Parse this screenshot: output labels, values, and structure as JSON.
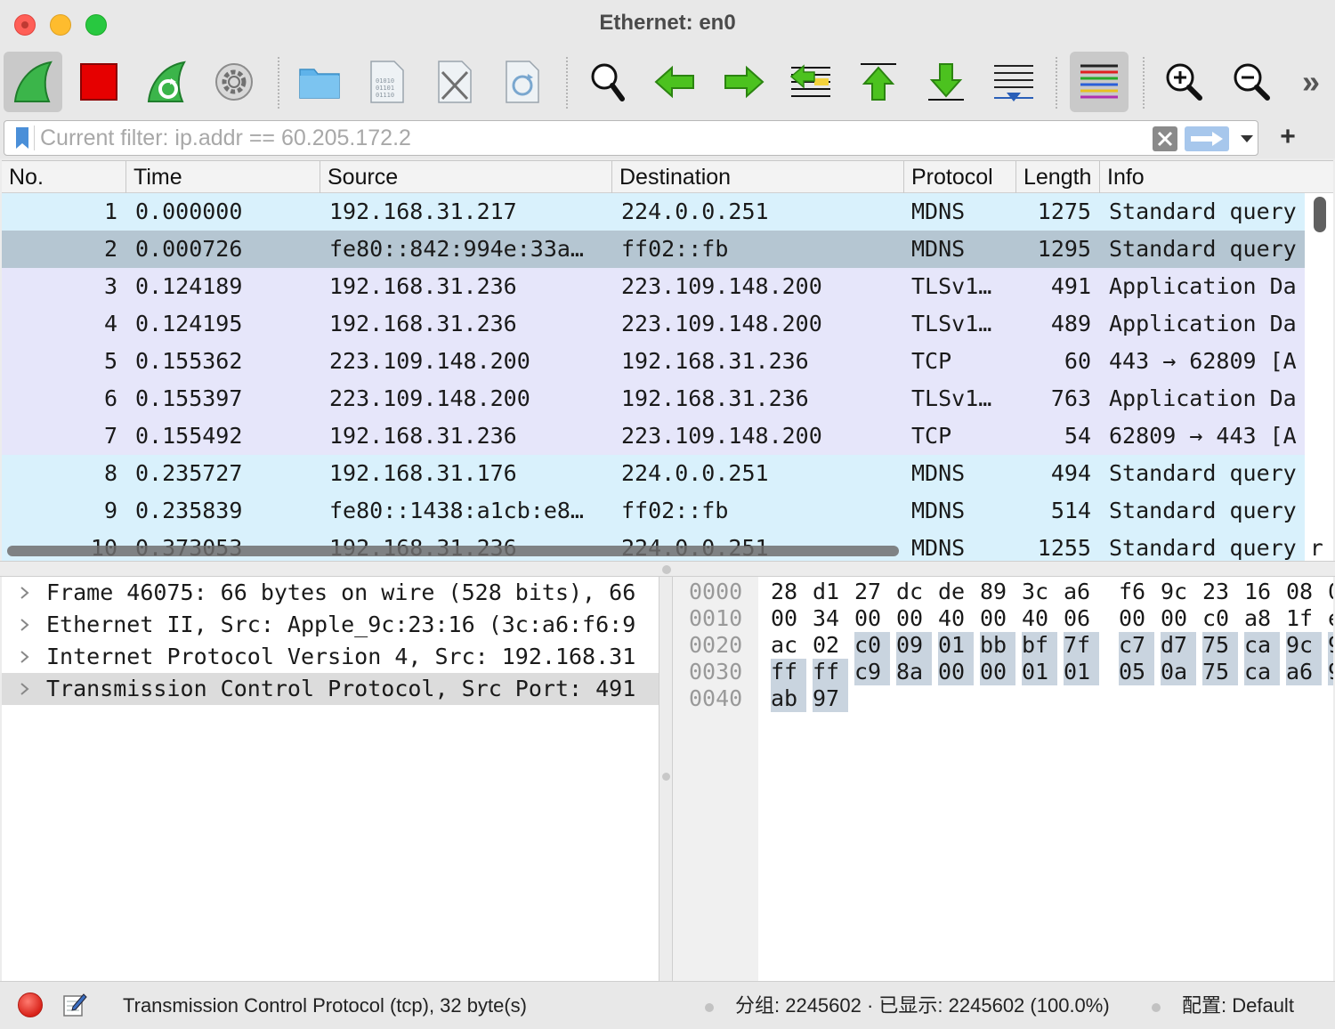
{
  "window": {
    "title": "Ethernet: en0"
  },
  "toolbar": {
    "buttons": [
      {
        "name": "start-capture",
        "icon": "shark-fin-icon"
      },
      {
        "name": "stop-capture",
        "icon": "stop-square-icon"
      },
      {
        "name": "restart-capture",
        "icon": "restart-fin-icon"
      },
      {
        "name": "capture-options",
        "icon": "gear-icon"
      },
      {
        "name": "open-file",
        "icon": "folder-icon"
      },
      {
        "name": "save-file",
        "icon": "binary-file-icon"
      },
      {
        "name": "close-file",
        "icon": "close-file-icon"
      },
      {
        "name": "reload-file",
        "icon": "reload-file-icon"
      },
      {
        "name": "find-packet",
        "icon": "magnifier-icon"
      },
      {
        "name": "go-back",
        "icon": "arrow-left-icon"
      },
      {
        "name": "go-forward",
        "icon": "arrow-right-icon"
      },
      {
        "name": "go-to-packet",
        "icon": "goto-packet-icon"
      },
      {
        "name": "go-first",
        "icon": "arrow-up-first-icon"
      },
      {
        "name": "go-last",
        "icon": "arrow-down-last-icon"
      },
      {
        "name": "auto-scroll",
        "icon": "autoscroll-icon"
      },
      {
        "name": "colorize",
        "icon": "colorize-lines-icon"
      },
      {
        "name": "zoom-in",
        "icon": "zoom-in-icon"
      },
      {
        "name": "zoom-out",
        "icon": "zoom-out-icon"
      },
      {
        "name": "more",
        "icon": "double-chevron-right-icon"
      }
    ],
    "more_label": "»"
  },
  "filter": {
    "placeholder": "Current filter: ip.addr == 60.205.172.2",
    "value": "",
    "add_label": "+"
  },
  "packet_list": {
    "columns": [
      "No.",
      "Time",
      "Source",
      "Destination",
      "Protocol",
      "Length",
      "Info"
    ],
    "rows": [
      {
        "no": "1",
        "time": "0.000000",
        "source": "192.168.31.217",
        "destination": "224.0.0.251",
        "protocol": "MDNS",
        "length": "1275",
        "info": "Standard query",
        "bg": "#d9f1fc"
      },
      {
        "no": "2",
        "time": "0.000726",
        "source": "fe80::842:994e:33a…",
        "destination": "ff02::fb",
        "protocol": "MDNS",
        "length": "1295",
        "info": "Standard query",
        "bg": "#b5c6d2"
      },
      {
        "no": "3",
        "time": "0.124189",
        "source": "192.168.31.236",
        "destination": "223.109.148.200",
        "protocol": "TLSv1…",
        "length": "491",
        "info": "Application Da",
        "bg": "#e6e6fa"
      },
      {
        "no": "4",
        "time": "0.124195",
        "source": "192.168.31.236",
        "destination": "223.109.148.200",
        "protocol": "TLSv1…",
        "length": "489",
        "info": "Application Da",
        "bg": "#e6e6fa"
      },
      {
        "no": "5",
        "time": "0.155362",
        "source": "223.109.148.200",
        "destination": "192.168.31.236",
        "protocol": "TCP",
        "length": "60",
        "info": "443 → 62809 [A",
        "bg": "#e6e6fa"
      },
      {
        "no": "6",
        "time": "0.155397",
        "source": "223.109.148.200",
        "destination": "192.168.31.236",
        "protocol": "TLSv1…",
        "length": "763",
        "info": "Application Da",
        "bg": "#e6e6fa"
      },
      {
        "no": "7",
        "time": "0.155492",
        "source": "192.168.31.236",
        "destination": "223.109.148.200",
        "protocol": "TCP",
        "length": "54",
        "info": "62809 → 443 [A",
        "bg": "#e6e6fa"
      },
      {
        "no": "8",
        "time": "0.235727",
        "source": "192.168.31.176",
        "destination": "224.0.0.251",
        "protocol": "MDNS",
        "length": "494",
        "info": "Standard query",
        "bg": "#d9f1fc"
      },
      {
        "no": "9",
        "time": "0.235839",
        "source": "fe80::1438:a1cb:e8…",
        "destination": "ff02::fb",
        "protocol": "MDNS",
        "length": "514",
        "info": "Standard query",
        "bg": "#d9f1fc"
      },
      {
        "no": "10",
        "time": "0.373053",
        "source": "192.168.31.236",
        "destination": "224.0.0.251",
        "protocol": "MDNS",
        "length": "1255",
        "info": "Standard query r",
        "bg": "#d9f1fc"
      }
    ]
  },
  "details": {
    "rows": [
      {
        "text": "Frame 46075: 66 bytes on wire (528 bits), 66",
        "selected": false
      },
      {
        "text": "Ethernet II, Src: Apple_9c:23:16 (3c:a6:f6:9",
        "selected": false
      },
      {
        "text": "Internet Protocol Version 4, Src: 192.168.31",
        "selected": false
      },
      {
        "text": "Transmission Control Protocol, Src Port: 491",
        "selected": true
      }
    ]
  },
  "bytes": {
    "rows": [
      {
        "offset": "0000",
        "hex": [
          "28",
          "d1",
          "27",
          "dc",
          "de",
          "89",
          "3c",
          "a6",
          "f6",
          "9c",
          "23",
          "16",
          "08",
          "0"
        ],
        "hl_from": 99
      },
      {
        "offset": "0010",
        "hex": [
          "00",
          "34",
          "00",
          "00",
          "40",
          "00",
          "40",
          "06",
          "00",
          "00",
          "c0",
          "a8",
          "1f",
          "e"
        ],
        "hl_from": 99
      },
      {
        "offset": "0020",
        "hex": [
          "ac",
          "02",
          "c0",
          "09",
          "01",
          "bb",
          "bf",
          "7f",
          "c7",
          "d7",
          "75",
          "ca",
          "9c",
          "9"
        ],
        "hl_from": 2
      },
      {
        "offset": "0030",
        "hex": [
          "ff",
          "ff",
          "c9",
          "8a",
          "00",
          "00",
          "01",
          "01",
          "05",
          "0a",
          "75",
          "ca",
          "a6",
          "9"
        ],
        "hl_from": 0
      },
      {
        "offset": "0040",
        "hex": [
          "ab",
          "97"
        ],
        "hl_from": 0
      }
    ]
  },
  "status": {
    "message": "Transmission Control Protocol (tcp), 32 byte(s)",
    "packets": "分组: 2245602 · 已显示: 2245602 (100.0%)",
    "profile": "配置:  Default"
  }
}
